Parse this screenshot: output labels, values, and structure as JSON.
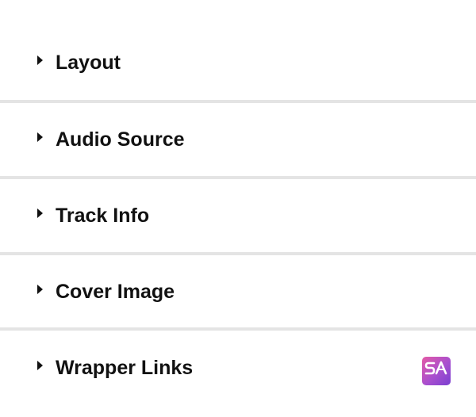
{
  "panels": [
    {
      "title": "Layout"
    },
    {
      "title": "Audio Source"
    },
    {
      "title": "Track Info"
    },
    {
      "title": "Cover Image"
    },
    {
      "title": "Wrapper Links"
    }
  ],
  "icons": {
    "caret": "caret-right-icon",
    "brand": "brand-logo-icon"
  },
  "brand": {
    "monogram": "SA",
    "accent_from": "#e45aa6",
    "accent_to": "#7a3fd0"
  },
  "colors": {
    "text": "#111111",
    "divider": "#e4e4e4",
    "background": "#ffffff"
  }
}
